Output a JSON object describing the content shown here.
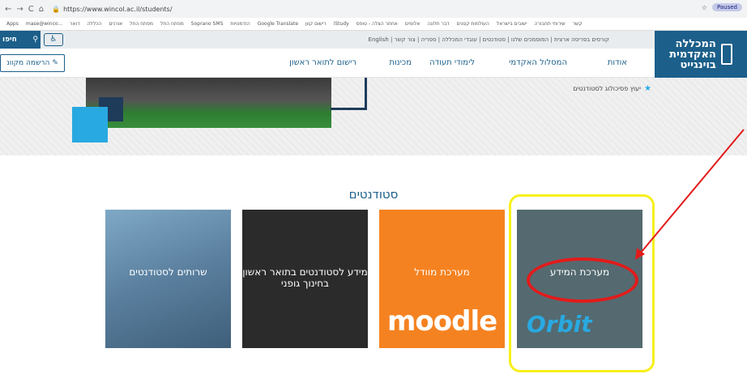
{
  "browser": {
    "url": "https://www.wincol.ac.il/students/",
    "paused": "Paused",
    "bookmarks": [
      "Apps",
      "mase@winco...",
      "דואר",
      "הכללה",
      "אורנים",
      "מפתח החל",
      "מפתח החל",
      "Soprano SMS",
      "הזדמנויות",
      "Google Translate",
      "רישום קוון",
      "iStudy",
      "אחתר הצלה - טופס",
      "אלומים",
      "דבר תלונה",
      "העולמות קטנים",
      "ישובים בישראל",
      "שירותי תחבורה",
      "קשר"
    ]
  },
  "site": {
    "logo": [
      "המכללה",
      "האקדמית",
      "בוינגייט"
    ],
    "search_label": "חיפו",
    "top_links": "English | קורסים בפריסה ארצית | המוסמכים שלנו | סטודנטים | עובדי המכללה | ספריה | צור קשר",
    "register_label": "הרשמה מקוונ",
    "nav": [
      "אודות",
      "המסלול האקדמי",
      "לימודי תעודה",
      "מכינות",
      "רישום לתואר ראשון"
    ],
    "psych_link": "יעוץ פסיכולוג לסטודנטים"
  },
  "students": {
    "title": "סטודנטים",
    "tiles": [
      {
        "label": "שרותים לסטודנטים"
      },
      {
        "label": "מידע לסטודנטים בתואר ראשון בחינוך גופני"
      },
      {
        "label": "מערכת מוודל",
        "logo": "moodle"
      },
      {
        "label": "מערכת המידע",
        "logo": "Orbit"
      }
    ]
  }
}
